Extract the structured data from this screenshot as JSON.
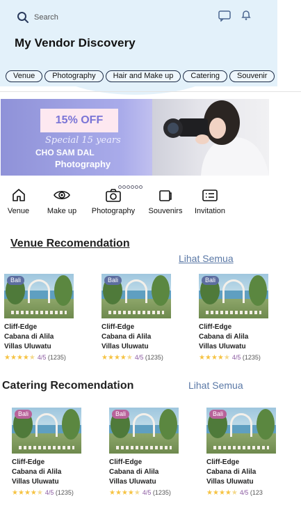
{
  "header": {
    "search_placeholder": "Search",
    "title": "My Vendor Discovery"
  },
  "chips": [
    "Venue",
    "Photography",
    "Hair and Make up",
    "Catering",
    "Souvenir"
  ],
  "banner": {
    "offer": "15% OFF",
    "tagline": "Special 15 years",
    "name": "CHO SAM DAL",
    "subtitle": "Photography",
    "dots": 6
  },
  "categories": [
    {
      "label": "Venue",
      "icon": "home-icon"
    },
    {
      "label": "Make up",
      "icon": "eye-icon"
    },
    {
      "label": "Photography",
      "icon": "camera-icon"
    },
    {
      "label": "Souvenirs",
      "icon": "gift-icon"
    },
    {
      "label": "Invitation",
      "icon": "invitation-icon"
    }
  ],
  "venue_section": {
    "title": "Venue Recomendation",
    "see_all": "Lihat Semua",
    "cards": [
      {
        "badge": "Bali",
        "line1": "Cliff-Edge",
        "line2": "Cabana di Alila",
        "line3": "Villas Uluwatu",
        "rating": "4/5",
        "count": "(1235)",
        "stars": 4.5
      },
      {
        "badge": "Bali",
        "line1": "Cliff-Edge",
        "line2": "Cabana di Alila",
        "line3": "Villas Uluwatu",
        "rating": "4/5",
        "count": "(1235)",
        "stars": 4.5
      },
      {
        "badge": "Bali",
        "line1": "Cliff-Edge",
        "line2": "Cabana di Alila",
        "line3": "Villas Uluwatu",
        "rating": "4/5",
        "count": "(1235)",
        "stars": 4.5
      }
    ]
  },
  "catering_section": {
    "title": "Catering Recomendation",
    "see_all": "Lihat Semua",
    "cards": [
      {
        "badge": "Bali",
        "line1": "Cliff-Edge",
        "line2": "Cabana di Alila",
        "line3": "Villas Uluwatu",
        "rating": "4/5",
        "count": "(1235)",
        "stars": 4.5
      },
      {
        "badge": "Bali",
        "line1": "Cliff-Edge",
        "line2": "Cabana di Alila",
        "line3": "Villas Uluwatu",
        "rating": "4/5",
        "count": "(1235)",
        "stars": 4.5
      },
      {
        "badge": "Bali",
        "line1": "Cliff-Edge",
        "line2": "Cabana di Alila",
        "line3": "Villas Uluwatu",
        "rating": "4/5",
        "count": "(123",
        "stars": 4.5
      }
    ]
  },
  "colors": {
    "header_bg": "#e3f1fa",
    "link": "#5a78a6",
    "star": "#f6c343",
    "rating_text": "#8b5aa0",
    "badge_venue": "#5d6ea0",
    "badge_catering": "#b8629a"
  }
}
